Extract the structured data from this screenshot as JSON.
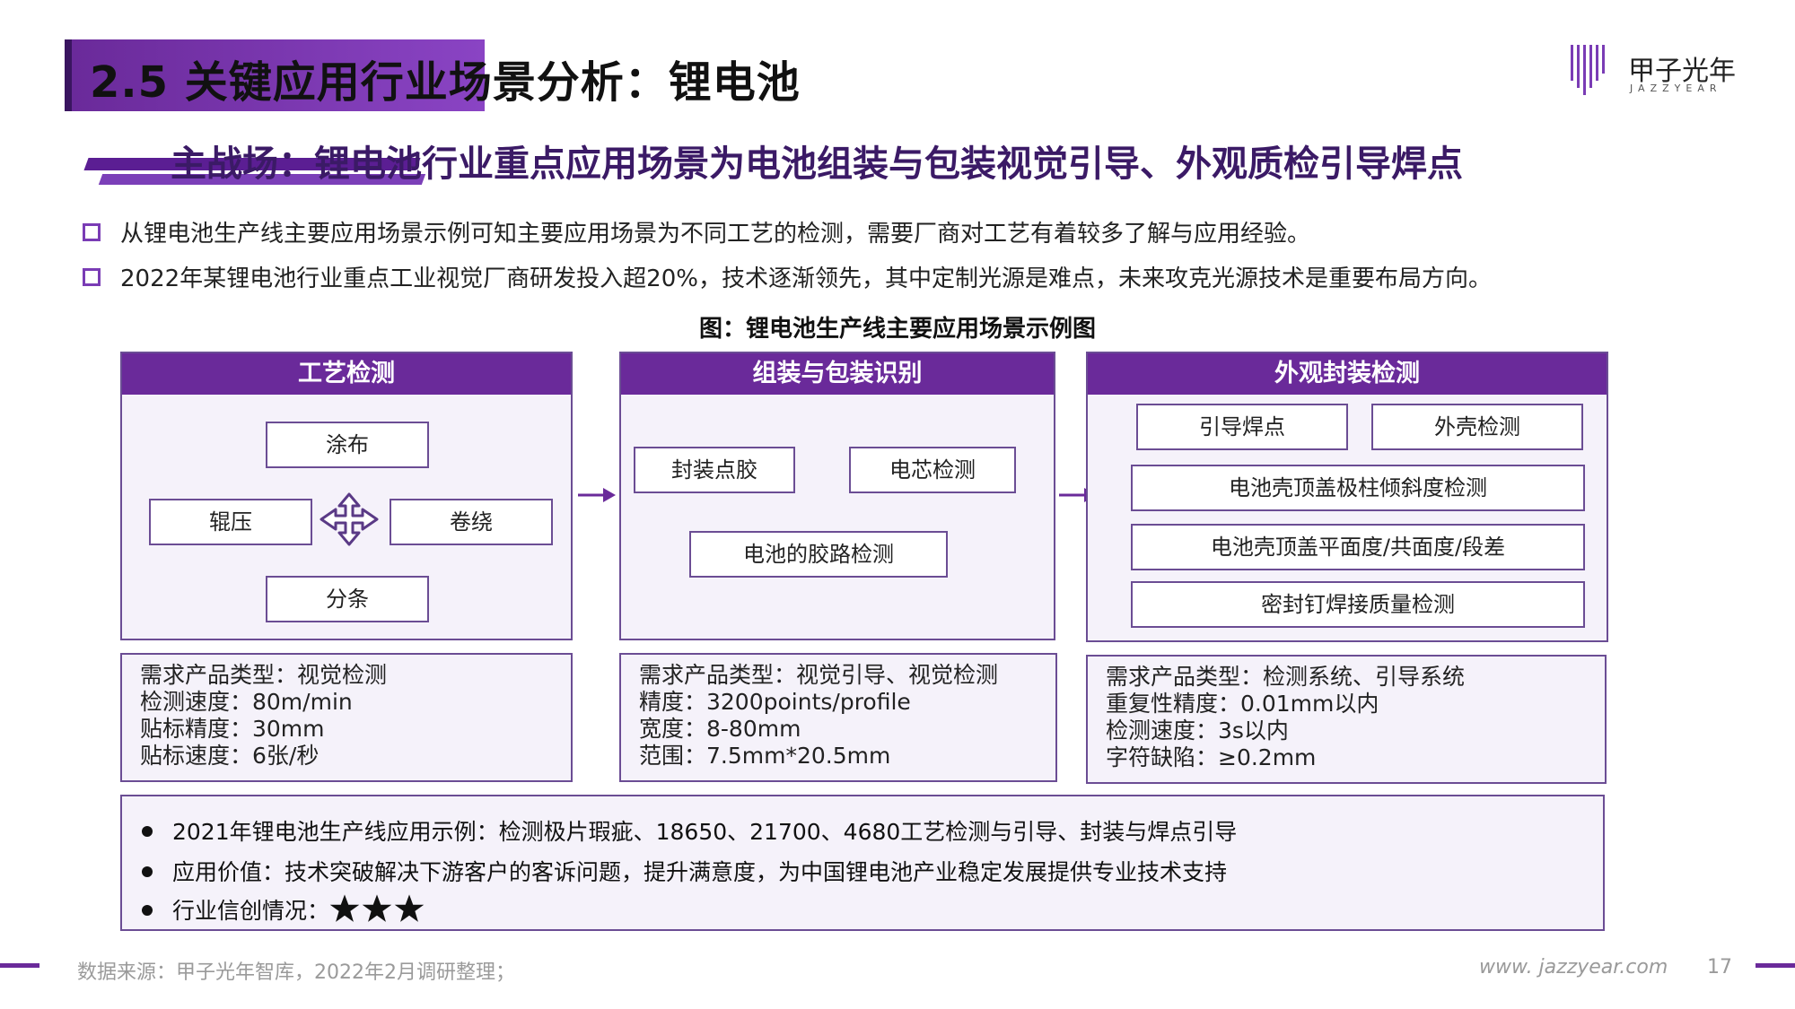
{
  "header": {
    "title": "2.5 关键应用行业场景分析：锂电池",
    "logo_cn": "甲子光年",
    "logo_en": "JAZZYEAR"
  },
  "subtitle": "主战场：锂电池行业重点应用场景为电池组装与包装视觉引导、外观质检引导焊点",
  "bullets": [
    "从锂电池生产线主要应用场景示例可知主要应用场景为不同工艺的检测，需要厂商对工艺有着较多了解与应用经验。",
    "2022年某锂电池行业重点工业视觉厂商研发投入超20%，技术逐渐领先，其中定制光源是难点，未来攻克光源技术是重要布局方向。"
  ],
  "figure_caption": "图：锂电池生产线主要应用场景示例图",
  "panels": [
    {
      "title": "工艺检测",
      "items": [
        "涂布",
        "辊压",
        "卷绕",
        "分条"
      ],
      "info": [
        "需求产品类型：视觉检测",
        "检测速度：80m/min",
        "贴标精度：30mm",
        "贴标速度：6张/秒"
      ]
    },
    {
      "title": "组装与包装识别",
      "items": [
        "封装点胶",
        "电芯检测",
        "电池的胶路检测"
      ],
      "info": [
        "需求产品类型：视觉引导、视觉检测",
        "精度：3200points/profile",
        "宽度：8-80mm",
        "范围：7.5mm*20.5mm"
      ]
    },
    {
      "title": "外观封装检测",
      "items": [
        "引导焊点",
        "外壳检测",
        "电池壳顶盖极柱倾斜度检测",
        "电池壳顶盖平面度/共面度/段差",
        "密封钉焊接质量检测"
      ],
      "info": [
        "需求产品类型：检测系统、引导系统",
        "重复性精度：0.01mm以内",
        "检测速度：3s以内",
        "字符缺陷：≥0.2mm"
      ]
    }
  ],
  "summary": [
    "2021年锂电池生产线应用示例：检测极片瑕疵、18650、21700、4680工艺检测与引导、封装与焊点引导",
    "应用价值：技术突破解决下游客户的客诉问题，提升满意度，为中国锂电池产业稳定发展提供专业技术支持",
    "行业信创情况："
  ],
  "rating": {
    "stars": 3
  },
  "footer": {
    "source": "数据来源：甲子光年智库，2022年2月调研整理；",
    "url": "www. jazzyear.com",
    "page": "17"
  },
  "colors": {
    "accent": "#6a2a9a",
    "border": "#6b4d94",
    "panel_bg": "#f5f2fa"
  }
}
